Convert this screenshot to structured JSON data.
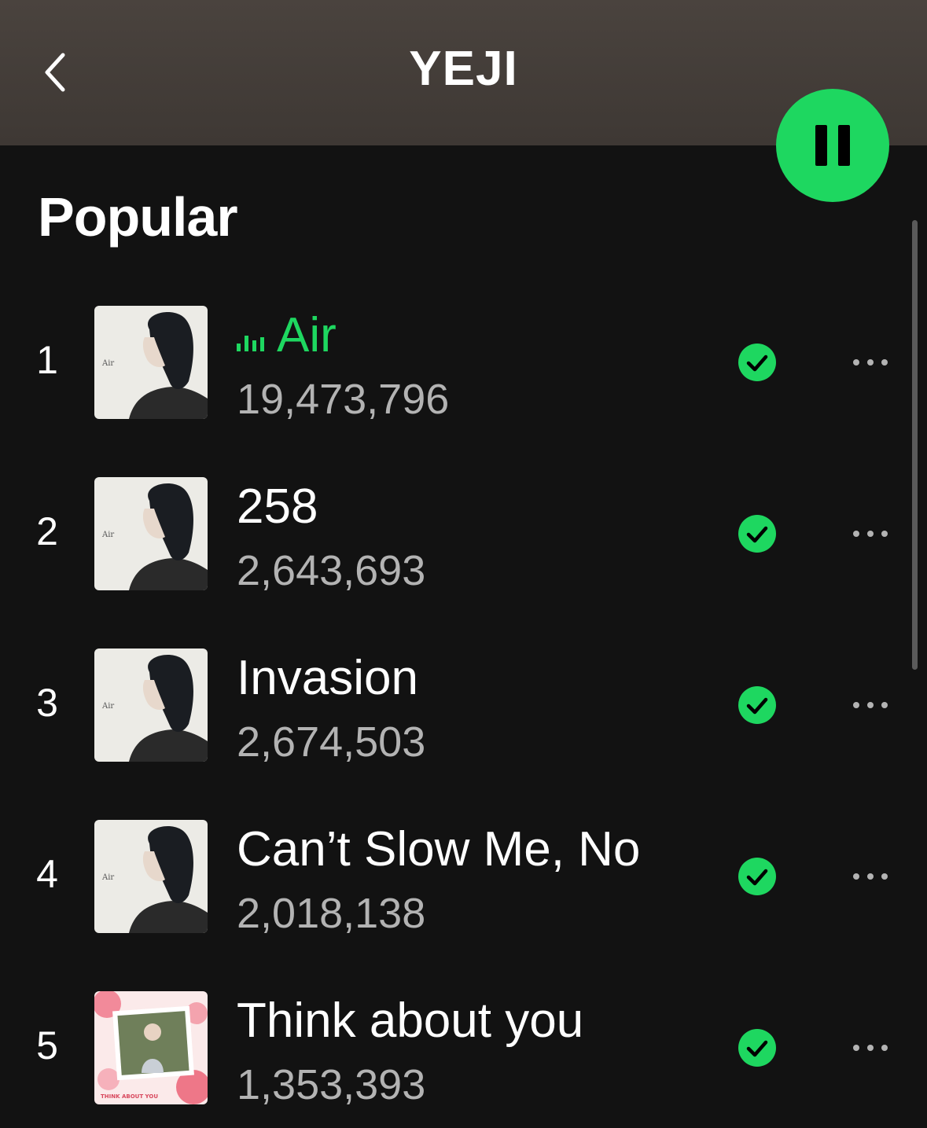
{
  "header": {
    "title": "YEJI",
    "back_icon": "chevron-left-icon",
    "pause_icon": "pause-icon",
    "accent_color": "#1ed760"
  },
  "popular": {
    "heading": "Popular",
    "tracks": [
      {
        "rank": "1",
        "title": "Air",
        "plays": "19,473,796",
        "playing": true,
        "cover": "air-album-cover",
        "saved_icon": "check-circle-icon",
        "more_icon": "more-icon"
      },
      {
        "rank": "2",
        "title": "258",
        "plays": "2,643,693",
        "playing": false,
        "cover": "air-album-cover",
        "saved_icon": "check-circle-icon",
        "more_icon": "more-icon"
      },
      {
        "rank": "3",
        "title": "Invasion",
        "plays": "2,674,503",
        "playing": false,
        "cover": "air-album-cover",
        "saved_icon": "check-circle-icon",
        "more_icon": "more-icon"
      },
      {
        "rank": "4",
        "title": "Can’t Slow Me, No",
        "plays": "2,018,138",
        "playing": false,
        "cover": "air-album-cover",
        "saved_icon": "check-circle-icon",
        "more_icon": "more-icon"
      },
      {
        "rank": "5",
        "title": "Think about you",
        "plays": "1,353,393",
        "playing": false,
        "cover": "think-about-you-cover",
        "saved_icon": "check-circle-icon",
        "more_icon": "more-icon"
      }
    ]
  }
}
